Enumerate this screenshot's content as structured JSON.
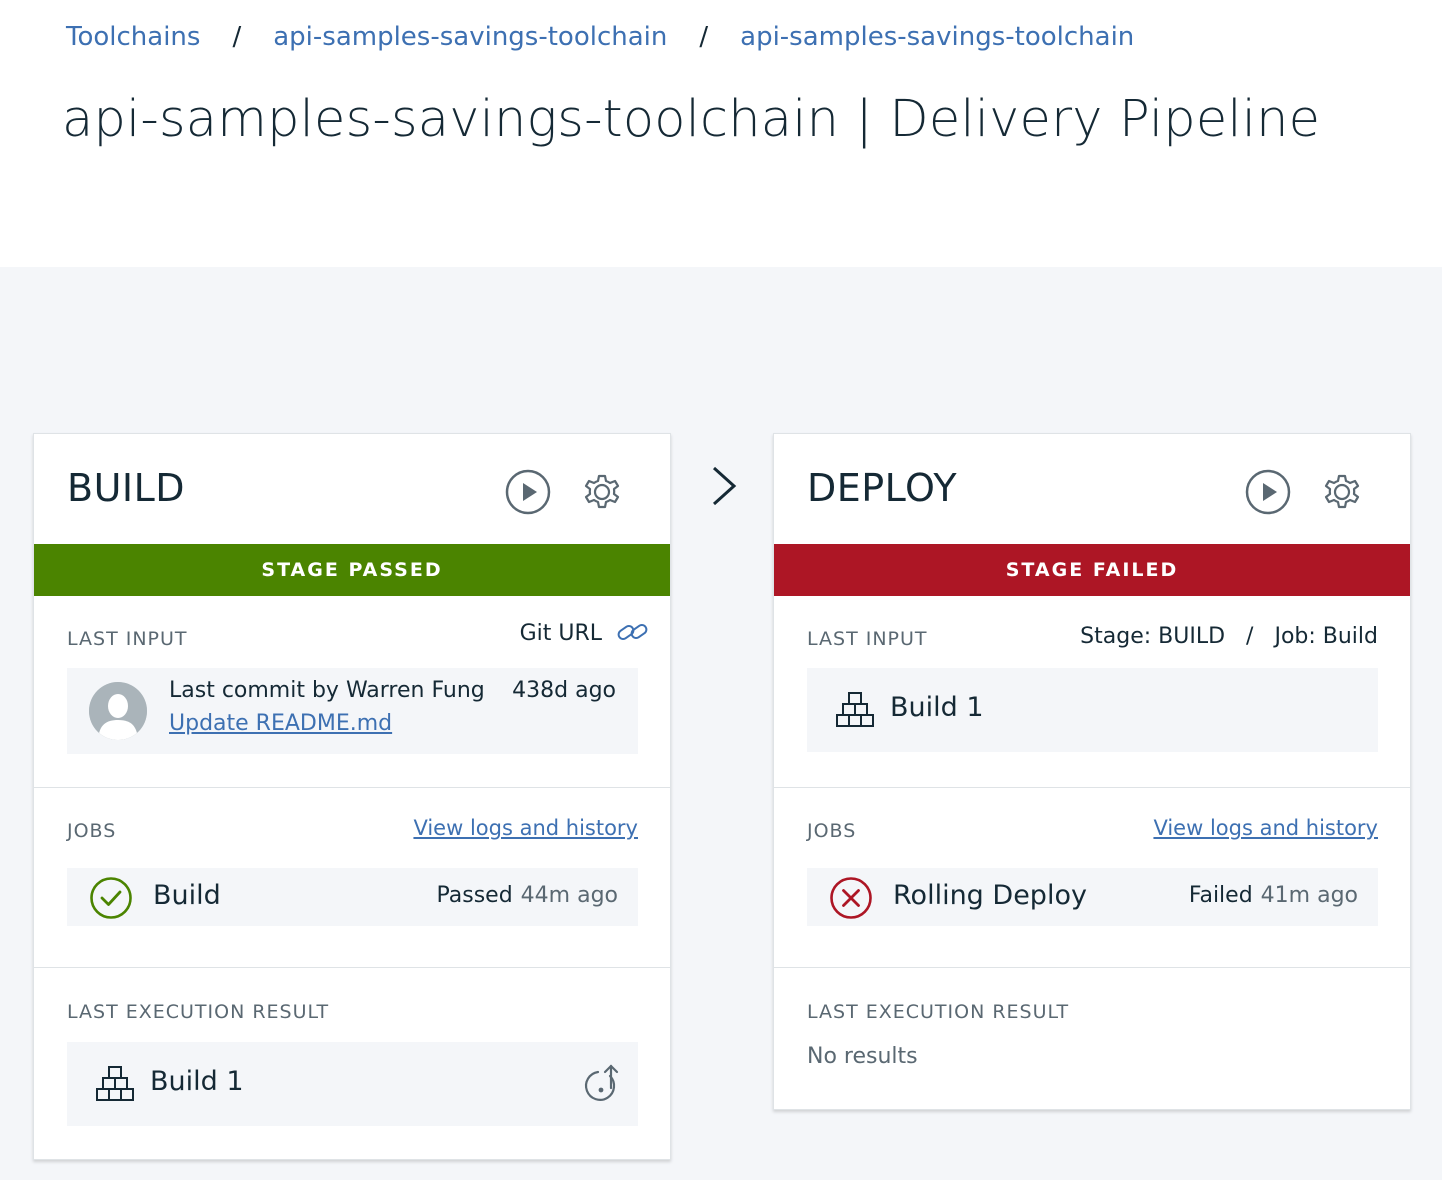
{
  "breadcrumb": {
    "items": [
      "Toolchains",
      "api-samples-savings-toolchain",
      "api-samples-savings-toolchain"
    ],
    "separator": "/"
  },
  "page": {
    "title": "api-samples-savings-toolchain | Delivery Pipeline"
  },
  "colors": {
    "passed": "#4b8400",
    "failed": "#ad1625",
    "link": "#3d70b2",
    "canvas_bg": "#f4f6f9"
  },
  "stages": {
    "build": {
      "name": "BUILD",
      "status": "STAGE PASSED",
      "last_input_label": "LAST INPUT",
      "git_url_label": "Git URL",
      "commit_text": "Last commit by Warren Fung",
      "commit_message": "Update README.md",
      "commit_age": "438d ago",
      "jobs_label": "JOBS",
      "view_logs": "View logs and history",
      "job": {
        "name": "Build",
        "status": "Passed",
        "age": "44m ago",
        "icon": "check-circle-icon"
      },
      "last_exec_label": "LAST EXECUTION RESULT",
      "last_exec_value": "Build 1"
    },
    "deploy": {
      "name": "DEPLOY",
      "status": "STAGE FAILED",
      "last_input_label": "LAST INPUT",
      "input_stage": "Stage: BUILD",
      "input_sep": "/",
      "input_job": "Job: Build",
      "input_value": "Build 1",
      "jobs_label": "JOBS",
      "view_logs": "View logs and history",
      "job": {
        "name": "Rolling Deploy",
        "status": "Failed",
        "age": "41m ago",
        "icon": "error-circle-icon"
      },
      "last_exec_label": "LAST EXECUTION RESULT",
      "last_exec_value": "No results"
    }
  }
}
